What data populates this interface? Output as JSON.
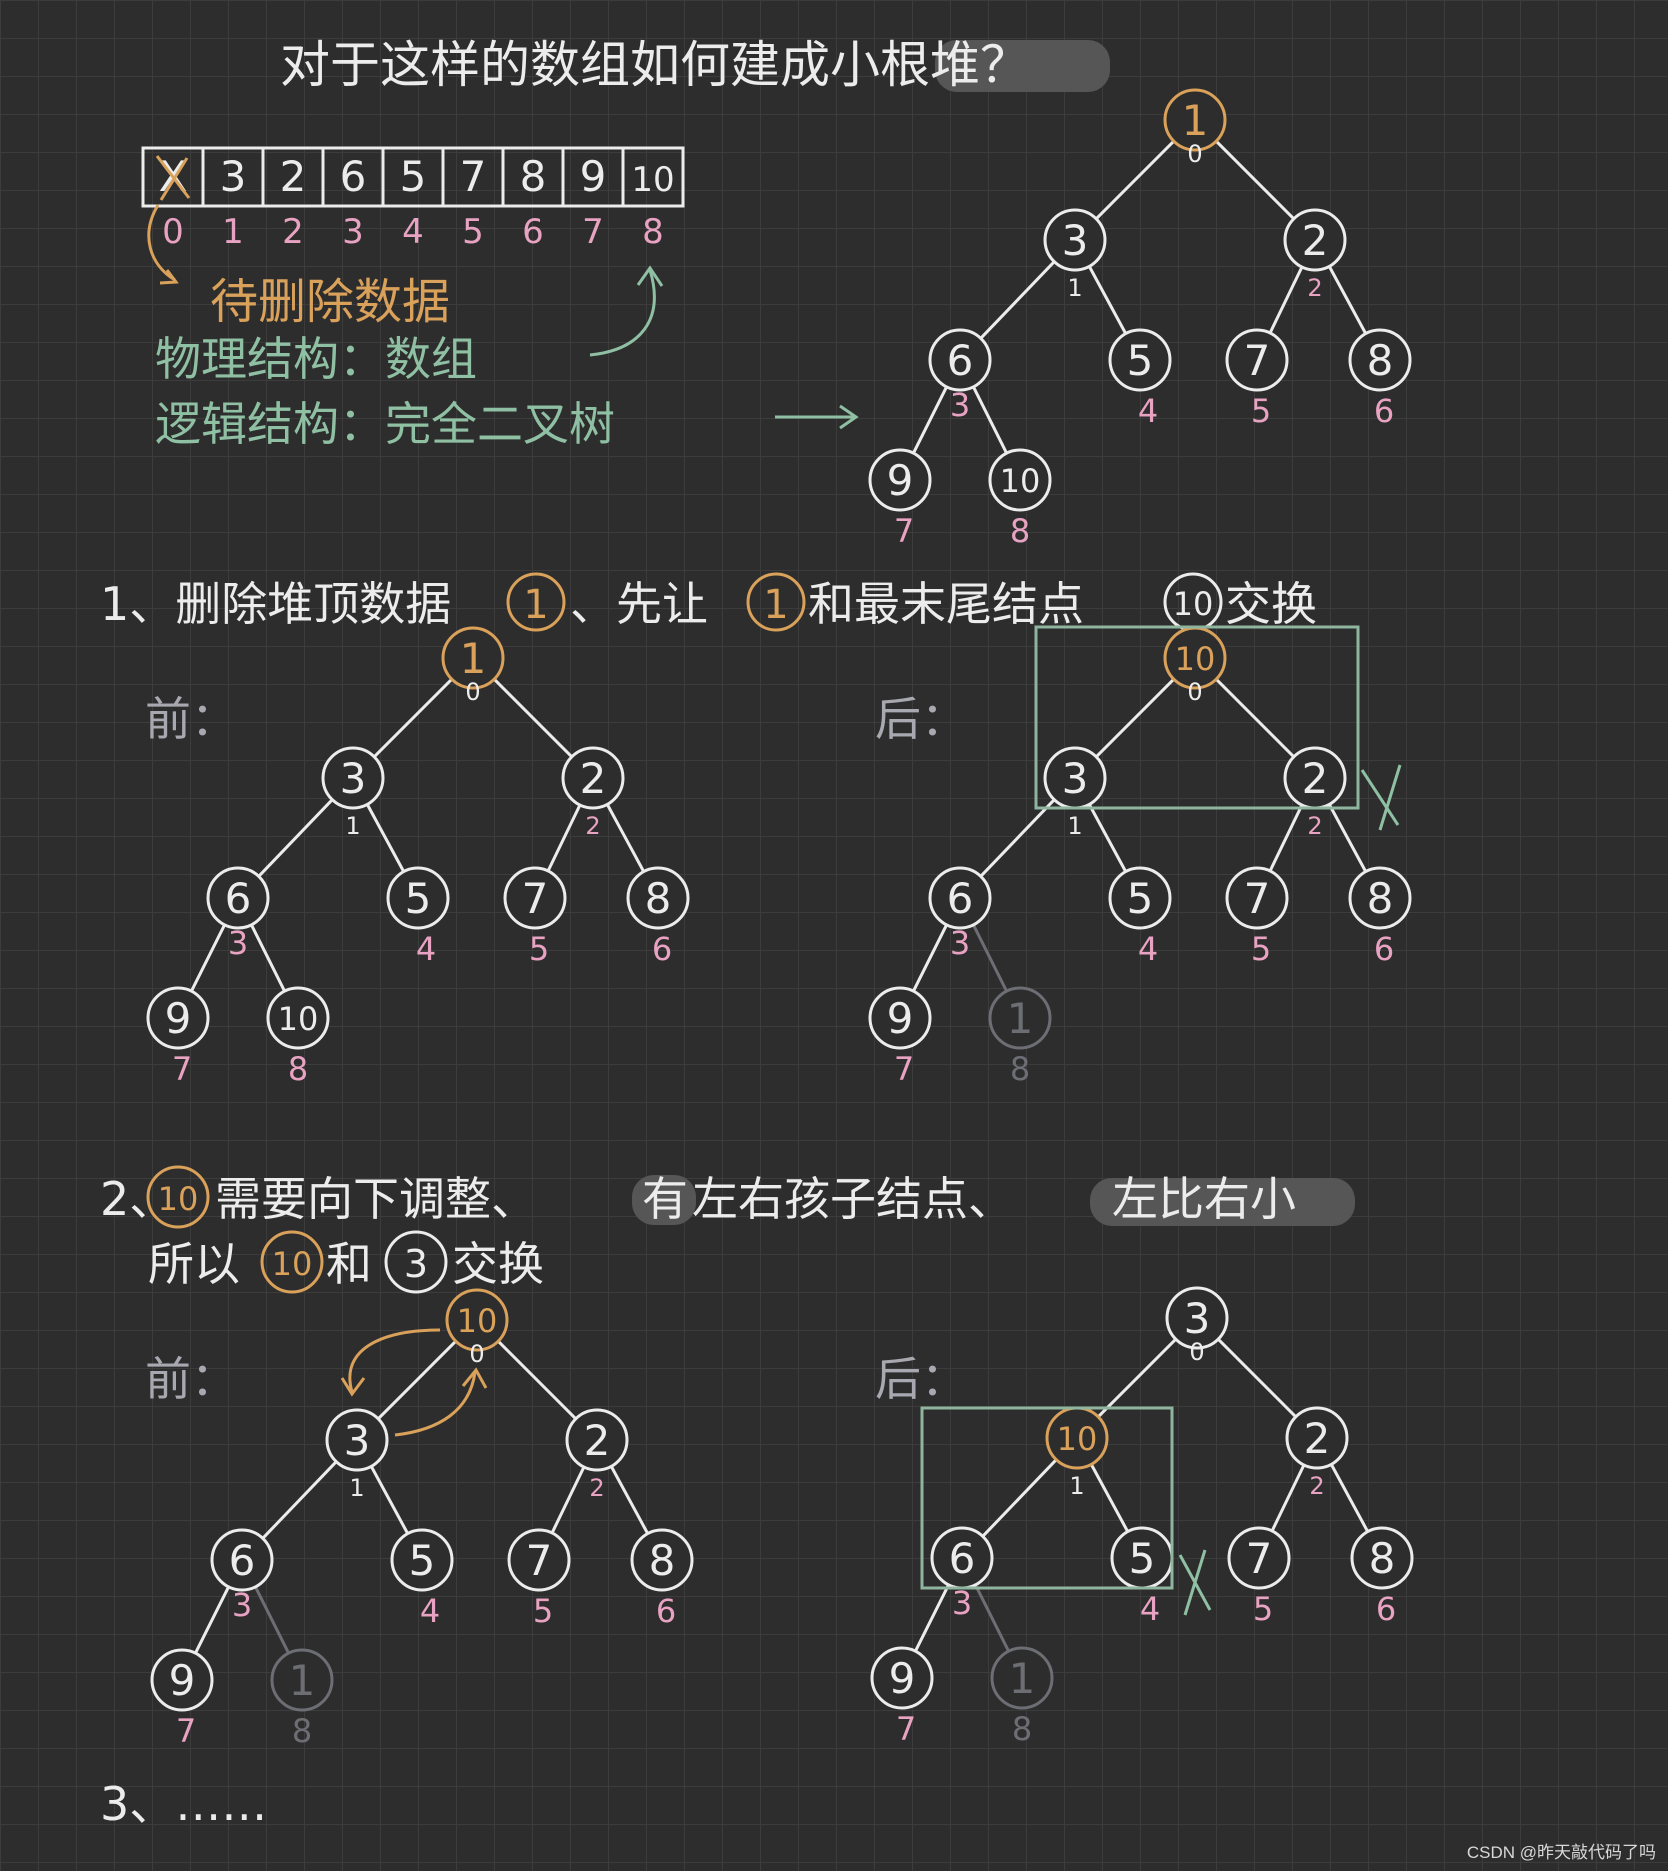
{
  "title": "对于这样的数组如何建成小根堆？",
  "array": {
    "cells": [
      "X",
      "3",
      "2",
      "6",
      "5",
      "7",
      "8",
      "9",
      "10"
    ],
    "indices": [
      "0",
      "1",
      "2",
      "3",
      "4",
      "5",
      "6",
      "7",
      "8"
    ]
  },
  "notes": {
    "pending_delete": "待删除数据",
    "physical": "物理结构：数组",
    "logical": "逻辑结构：完全二叉树"
  },
  "step1": {
    "prefix": "1、删除堆顶数据",
    "mid": "、先让",
    "mid2": "和最末尾结点",
    "suffix": "交换",
    "root_label": "1",
    "last_label": "10"
  },
  "step2": {
    "prefix": "2、",
    "line1_a": "需要向下调整、",
    "highlight1": "有",
    "line1_b": "左右孩子结点、",
    "highlight2": "左比右小",
    "line2_a": "所以",
    "line2_b": "和",
    "line2_c": "交换",
    "node_a": "10",
    "node_b": "3"
  },
  "step3": {
    "text": "3、……"
  },
  "labels": {
    "before": "前：",
    "after": "后："
  },
  "trees": {
    "top": {
      "nodes": [
        {
          "v": "1",
          "i": "0"
        },
        {
          "v": "3",
          "i": "1"
        },
        {
          "v": "2",
          "i": "2"
        },
        {
          "v": "6",
          "i": "3"
        },
        {
          "v": "5",
          "i": "4"
        },
        {
          "v": "7",
          "i": "5"
        },
        {
          "v": "8",
          "i": "6"
        },
        {
          "v": "9",
          "i": "7"
        },
        {
          "v": "10",
          "i": "8"
        }
      ]
    },
    "s1_before": {
      "nodes": [
        {
          "v": "1",
          "i": "0"
        },
        {
          "v": "3",
          "i": "1"
        },
        {
          "v": "2",
          "i": "2"
        },
        {
          "v": "6",
          "i": "3"
        },
        {
          "v": "5",
          "i": "4"
        },
        {
          "v": "7",
          "i": "5"
        },
        {
          "v": "8",
          "i": "6"
        },
        {
          "v": "9",
          "i": "7"
        },
        {
          "v": "10",
          "i": "8"
        }
      ]
    },
    "s1_after": {
      "nodes": [
        {
          "v": "10",
          "i": "0"
        },
        {
          "v": "3",
          "i": "1"
        },
        {
          "v": "2",
          "i": "2"
        },
        {
          "v": "6",
          "i": "3"
        },
        {
          "v": "5",
          "i": "4"
        },
        {
          "v": "7",
          "i": "5"
        },
        {
          "v": "8",
          "i": "6"
        },
        {
          "v": "9",
          "i": "7"
        },
        {
          "v": "1",
          "i": "8"
        }
      ]
    },
    "s2_before": {
      "nodes": [
        {
          "v": "10",
          "i": "0"
        },
        {
          "v": "3",
          "i": "1"
        },
        {
          "v": "2",
          "i": "2"
        },
        {
          "v": "6",
          "i": "3"
        },
        {
          "v": "5",
          "i": "4"
        },
        {
          "v": "7",
          "i": "5"
        },
        {
          "v": "8",
          "i": "6"
        },
        {
          "v": "9",
          "i": "7"
        },
        {
          "v": "1",
          "i": "8"
        }
      ]
    },
    "s2_after": {
      "nodes": [
        {
          "v": "3",
          "i": "0"
        },
        {
          "v": "10",
          "i": "1"
        },
        {
          "v": "2",
          "i": "2"
        },
        {
          "v": "6",
          "i": "3"
        },
        {
          "v": "5",
          "i": "4"
        },
        {
          "v": "7",
          "i": "5"
        },
        {
          "v": "8",
          "i": "6"
        },
        {
          "v": "9",
          "i": "7"
        },
        {
          "v": "1",
          "i": "8"
        }
      ]
    }
  },
  "watermark": "CSDN @昨天敲代码了吗",
  "colors": {
    "chalk": "#ececec",
    "orange": "#d9a15a",
    "green": "#8fc0a3",
    "pink": "#e8a3c2",
    "gray": "#6c6e74",
    "box": "#8fb59e",
    "highlight": "#565656"
  }
}
